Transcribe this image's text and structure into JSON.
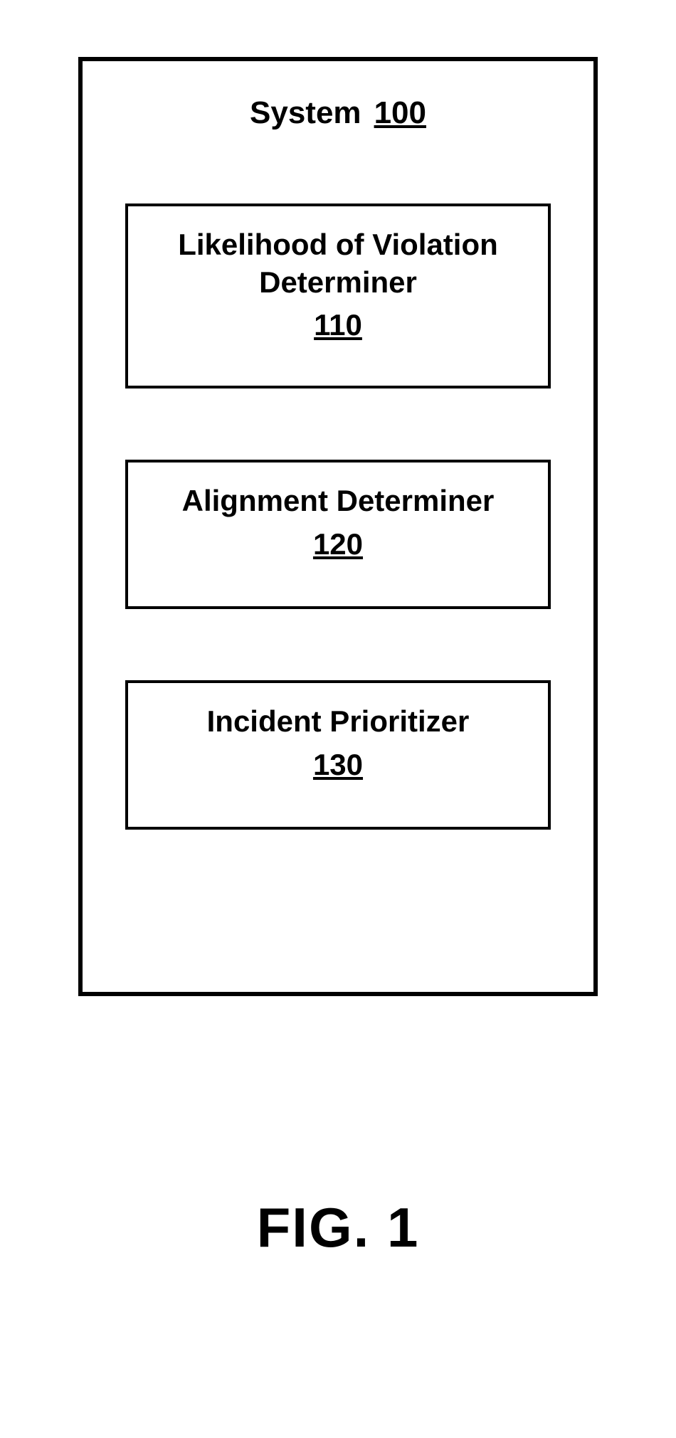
{
  "system": {
    "label": "System",
    "ref": "100"
  },
  "boxes": {
    "b1": {
      "title": "Likelihood of Violation Determiner",
      "ref": "110"
    },
    "b2": {
      "title": "Alignment Determiner",
      "ref": "120"
    },
    "b3": {
      "title": "Incident Prioritizer",
      "ref": "130"
    }
  },
  "figure_label": "FIG. 1"
}
